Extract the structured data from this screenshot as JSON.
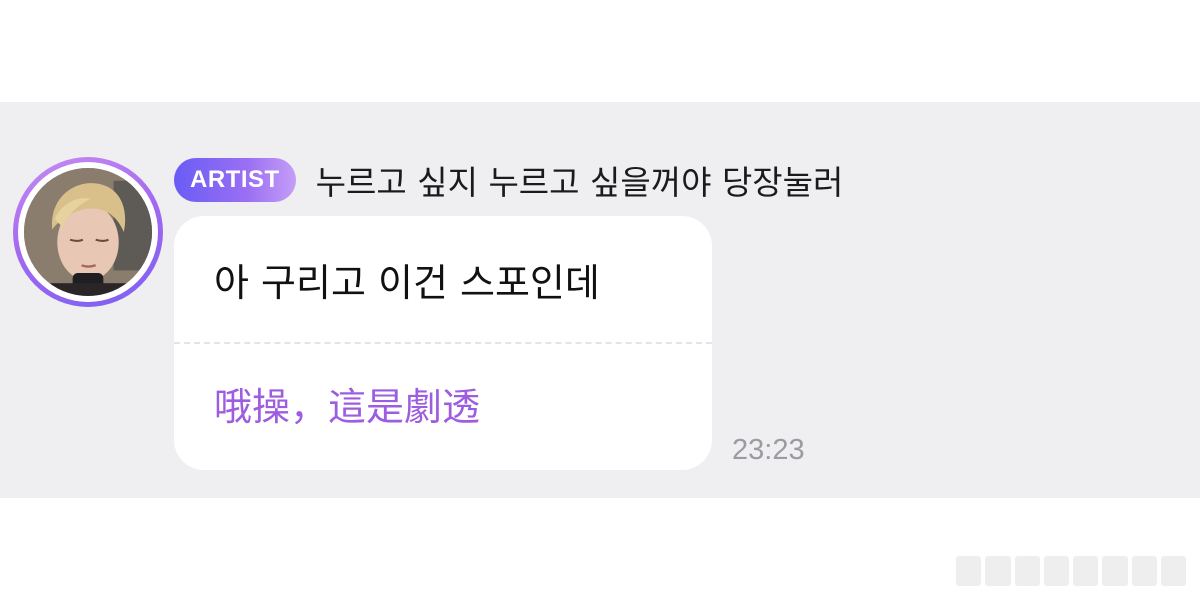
{
  "message": {
    "badge_label": "ARTIST",
    "sender_name": "누르고 싶지 누르고 싶을꺼야 당장눌러",
    "original_text": "아 구리고 이건 스포인데",
    "translated_text": "哦操，這是劇透",
    "timestamp": "23:23"
  },
  "colors": {
    "band_background": "#efeff1",
    "translation_text": "#9d5de0",
    "badge_gradient_start": "#6a5cf5",
    "badge_gradient_end": "#c59df6",
    "timestamp_text": "#9b9ba1"
  }
}
